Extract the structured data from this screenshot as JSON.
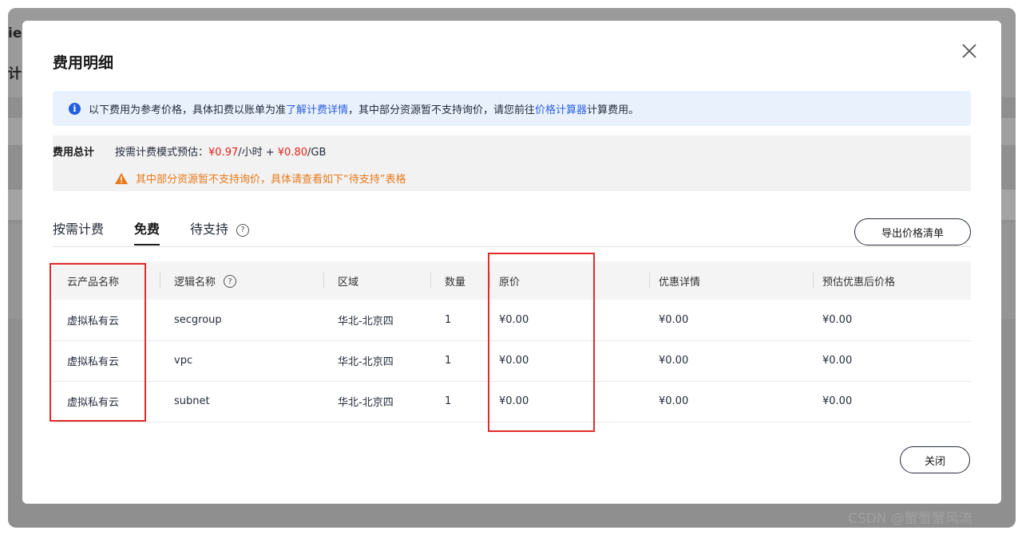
{
  "background": {
    "partial_text_1": "ie",
    "partial_text_2": "计"
  },
  "modal": {
    "title": "费用明细",
    "info": {
      "text_before": "以下费用为参考价格，具体扣费以账单为准",
      "link1": "了解计费详情",
      "text_middle": "，其中部分资源暂不支持询价，请您前往",
      "link2": "价格计算器",
      "text_after": "计算费用。"
    },
    "summary": {
      "label": "费用总计",
      "estimate_prefix": "按需计费模式预估：",
      "price_hourly": "¥0.97",
      "unit_hourly": "/小时 +",
      "price_gb": "¥0.80",
      "unit_gb": "/GB",
      "warning": "其中部分资源暂不支持询价，具体请查看如下“待支持”表格"
    },
    "tabs": [
      {
        "label": "按需计费"
      },
      {
        "label": "免费"
      },
      {
        "label": "待支持"
      }
    ],
    "active_tab": "免费",
    "export_label": "导出价格清单",
    "table": {
      "headers": [
        "云产品名称",
        "逻辑名称",
        "区域",
        "数量",
        "原价",
        "优惠详情",
        "预估优惠后价格"
      ],
      "rows": [
        [
          "虚拟私有云",
          "secgroup",
          "华北-北京四",
          "1",
          "¥0.00",
          "¥0.00",
          "¥0.00"
        ],
        [
          "虚拟私有云",
          "vpc",
          "华北-北京四",
          "1",
          "¥0.00",
          "¥0.00",
          "¥0.00"
        ],
        [
          "虚拟私有云",
          "subnet",
          "华北-北京四",
          "1",
          "¥0.00",
          "¥0.00",
          "¥0.00"
        ]
      ]
    },
    "close_label": "关闭"
  },
  "watermark": "CSDN @蟹蟹蟹风流",
  "colors": {
    "accent": "#1f5fe0",
    "price": "#e2231a",
    "warning": "#e77a1a",
    "annotation": "#e12b2b"
  }
}
